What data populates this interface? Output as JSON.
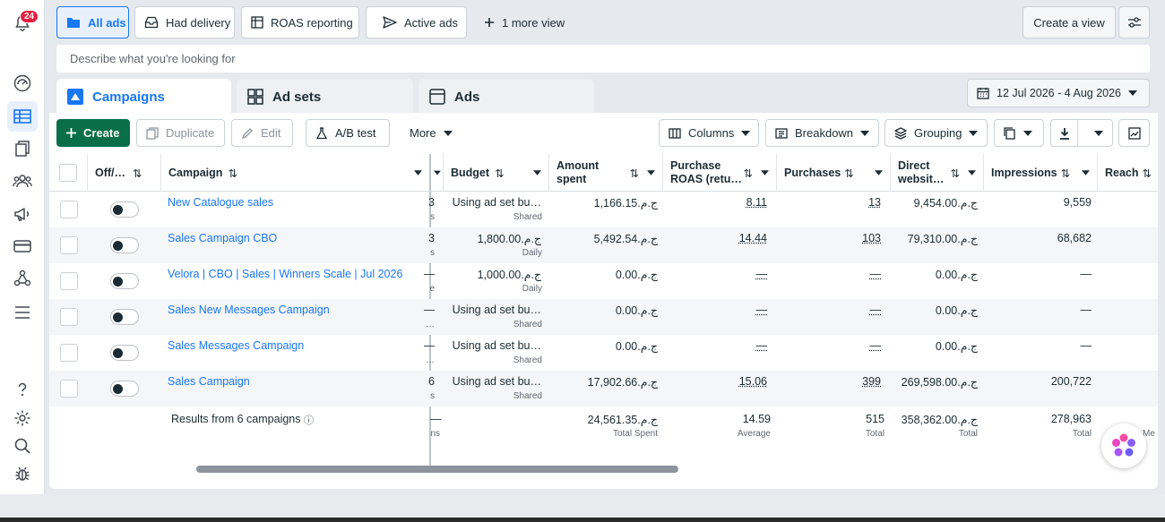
{
  "notifications": {
    "count": "24"
  },
  "views": {
    "all_ads": "All ads",
    "had_delivery": "Had delivery",
    "roas_reporting": "ROAS reporting",
    "active_ads": "Active ads",
    "more_view": "1 more view",
    "create_view": "Create a view"
  },
  "search": {
    "placeholder": "Describe what you're looking for"
  },
  "tabs": {
    "campaigns": "Campaigns",
    "ad_sets": "Ad sets",
    "ads": "Ads"
  },
  "date_range": "12 Jul 2026 - 4 Aug 2026",
  "toolbar": {
    "create": "Create",
    "duplicate": "Duplicate",
    "edit": "Edit",
    "ab_test": "A/B test",
    "more": "More",
    "columns": "Columns",
    "breakdown": "Breakdown",
    "grouping": "Grouping"
  },
  "table": {
    "headers": {
      "offon": "Off/…",
      "campaign": "Campaign",
      "budget": "Budget",
      "amount_spent_1": "Amount",
      "amount_spent_2": "spent",
      "roas_1": "Purchase",
      "roas_2": "ROAS (retu…",
      "purchases": "Purchases",
      "direct_1": "Direct",
      "direct_2": "websit…",
      "impressions": "Impressions",
      "reach": "Reach"
    },
    "rows": [
      {
        "name": "New Catalogue sales",
        "hidden_val": "3",
        "hidden_sub": "s",
        "budget": "Using ad set bu…",
        "budget_sub": "Shared",
        "spent": "1,166.15ج.م.‏",
        "roas": "8.11",
        "purchases": "13",
        "direct": "9,454.00ج.م.‏",
        "impressions": "9,559",
        "reach": ""
      },
      {
        "name": "Sales Campaign CBO",
        "hidden_val": "3",
        "hidden_sub": "s",
        "budget": "1,800.00ج.م.‏",
        "budget_sub": "Daily",
        "spent": "5,492.54ج.م.‏",
        "roas": "14.44",
        "purchases": "103",
        "direct": "79,310.00ج.م.‏",
        "impressions": "68,682",
        "reach": ""
      },
      {
        "name": "Velora | CBO | Sales | Winners Scale | Jul 2026",
        "hidden_val": "—",
        "hidden_sub": "e",
        "budget": "1,000.00ج.م.‏",
        "budget_sub": "Daily",
        "spent": "0.00ج.م.‏",
        "roas": "—",
        "purchases": "—",
        "direct": "0.00ج.م.‏",
        "impressions": "—",
        "reach": ""
      },
      {
        "name": "Sales New Messages Campaign",
        "hidden_val": "—",
        "hidden_sub": "…",
        "budget": "Using ad set bu…",
        "budget_sub": "Shared",
        "spent": "0.00ج.م.‏",
        "roas": "—",
        "purchases": "—",
        "direct": "0.00ج.م.‏",
        "impressions": "—",
        "reach": ""
      },
      {
        "name": "Sales Messages Campaign",
        "hidden_val": "—",
        "hidden_sub": "…",
        "budget": "Using ad set bu…",
        "budget_sub": "Shared",
        "spent": "0.00ج.م.‏",
        "roas": "—",
        "purchases": "—",
        "direct": "0.00ج.م.‏",
        "impressions": "—",
        "reach": ""
      },
      {
        "name": "Sales Campaign",
        "hidden_val": "6",
        "hidden_sub": "s",
        "budget": "Using ad set bu…",
        "budget_sub": "Shared",
        "spent": "17,902.66ج.م.‏",
        "roas": "15.06",
        "purchases": "399",
        "direct": "269,598.00ج.م.‏",
        "impressions": "200,722",
        "reach": ""
      }
    ],
    "summary": {
      "label": "Results from 6 campaigns",
      "hidden_val": "—",
      "hidden_sub": "ns",
      "spent": "24,561.35ج.م.‏",
      "spent_sub": "Total Spent",
      "roas": "14.59",
      "roas_sub": "Average",
      "purchases": "515",
      "purchases_sub": "Total",
      "direct": "358,362.00ج.م.‏",
      "direct_sub": "Total",
      "impressions": "278,963",
      "impressions_sub": "Total",
      "reach_sub": "Me"
    }
  }
}
